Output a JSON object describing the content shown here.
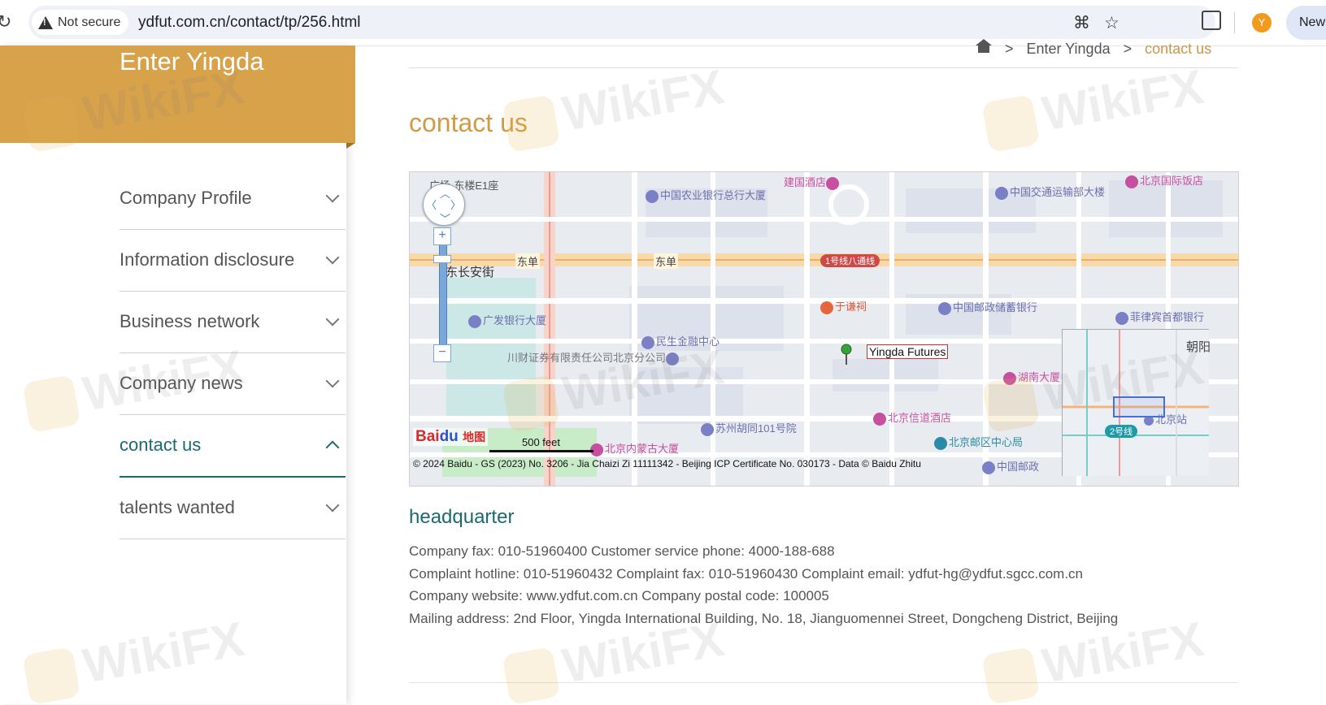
{
  "browser": {
    "security_label": "Not secure",
    "url": "ydfut.com.cn/contact/tp/256.html",
    "profile_initial": "Y",
    "new_chip_label": "New"
  },
  "sidebar": {
    "title": "Enter Yingda",
    "items": [
      {
        "label": "Company Profile",
        "active": false
      },
      {
        "label": "Information disclosure",
        "active": false
      },
      {
        "label": "Business network",
        "active": false
      },
      {
        "label": "Company news",
        "active": false
      },
      {
        "label": "contact us",
        "active": true
      },
      {
        "label": "talents wanted",
        "active": false
      }
    ]
  },
  "breadcrumb": {
    "separator": ">",
    "items": [
      "Enter Yingda",
      "contact us"
    ]
  },
  "page_title": "contact us",
  "map": {
    "marker_label": "Yingda Futures",
    "scale_label": "500 feet",
    "copyright": "© 2024 Baidu - GS (2023) No. 3206 - Jia Chaizi Zi 11111342 - Beijing ICP Certificate No. 030173 - Data © Baidu Zhitu",
    "logo_text_red": "Bai",
    "logo_text_blue": "du",
    "logo_suffix": "地图",
    "pois": {
      "p1": "中国农业银行总行大厦",
      "p2": "建国酒店",
      "p3": "中国交通运输部大楼",
      "p4": "北京国际饭店",
      "p5": "东单",
      "p6": "东单",
      "p7": "东长安街",
      "p8": "广发银行大厦",
      "p9": "民生金融中心",
      "p10": "于谦祠",
      "p11": "中国邮政储蓄银行",
      "p12": "菲律宾首都银行",
      "p13": "川财证券有限责任公司北京分公司",
      "p14": "湖南大厦",
      "p15": "北京信道酒店",
      "p16": "苏州胡同101号院",
      "p17": "北京邮区中心局",
      "p18": "北京内蒙古大厦",
      "p19": "中国邮政",
      "p20": "朝阳",
      "p21": "北京站",
      "p22": "广场-东楼E1座",
      "line1": "1号线八通线",
      "line2": "2号线"
    }
  },
  "headquarter": {
    "title": "headquarter",
    "lines": [
      "Company fax: 010-51960400 Customer service phone: 4000-188-688",
      "Complaint hotline: 010-51960432 Complaint fax: 010-51960430 Complaint email: ydfut-hg@ydfut.sgcc.com.cn",
      "Company website: www.ydfut.com.cn Company postal code: 100005",
      "Mailing address: 2nd Floor, Yingda International Building, No. 18, Jianguomennei Street, Dongcheng District, Beijing"
    ]
  },
  "watermark": "WikiFX",
  "colors": {
    "brand_gold": "#d8a24a",
    "title_gold": "#d39a45",
    "active_teal": "#1a6a70"
  }
}
